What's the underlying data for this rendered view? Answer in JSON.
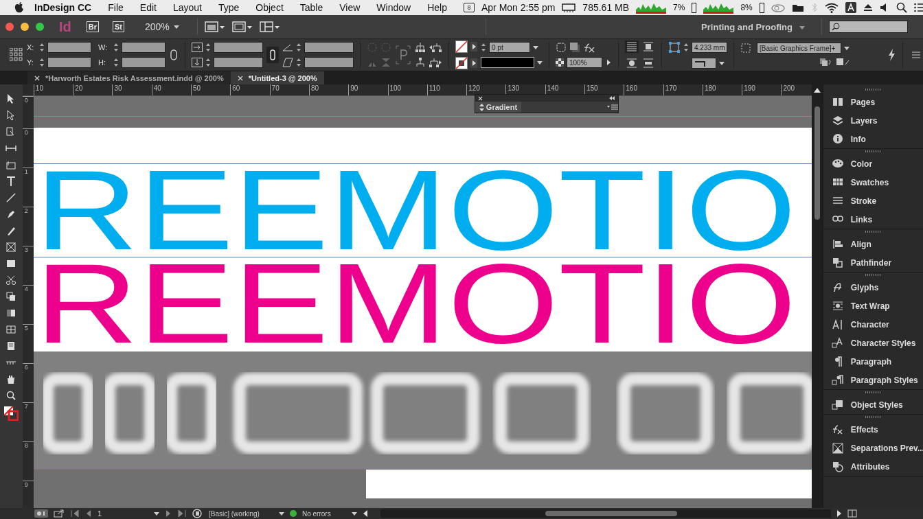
{
  "menu_bar": {
    "app_name": "InDesign CC",
    "menus": [
      "File",
      "Edit",
      "Layout",
      "Type",
      "Object",
      "Table",
      "View",
      "Window",
      "Help"
    ],
    "calendar_day": "8",
    "clock": "Apr Mon 2:55 pm",
    "memory": "785.61 MB",
    "cpu_1": "7%",
    "cpu_2": "8%"
  },
  "app_bar": {
    "logo": "Id",
    "bridge": "Br",
    "stock": "St",
    "zoom": "200%",
    "workspace": "Printing and Proofing"
  },
  "control_bar": {
    "x_label": "X:",
    "y_label": "Y:",
    "w_label": "W:",
    "h_label": "H:",
    "stroke_weight": "0 pt",
    "opacity": "100%",
    "offset": "4.233 mm",
    "object_style": "[Basic Graphics Frame]+"
  },
  "tabs": [
    {
      "label": "*Harworth Estates Risk Assessment.indd @ 200%",
      "selected": false
    },
    {
      "label": "*Untitled-3 @ 200%",
      "selected": true
    }
  ],
  "ruler": {
    "horizontal": [
      "10",
      "20",
      "30",
      "40",
      "50",
      "60",
      "70",
      "80",
      "90",
      "100",
      "110",
      "120",
      "130",
      "140",
      "150",
      "160",
      "170",
      "180",
      "190",
      "200"
    ],
    "vertical": [
      "0",
      "0",
      "1",
      "2",
      "3",
      "4",
      "5",
      "6",
      "7",
      "8",
      "9"
    ]
  },
  "gradient_panel": {
    "title": "Gradient"
  },
  "document": {
    "lines": [
      {
        "text": "REEMOTIO",
        "color": "#00aeef"
      },
      {
        "text": "REEMOTIO",
        "color": "#ec008c"
      }
    ]
  },
  "panels": [
    {
      "items": [
        "Pages",
        "Layers",
        "Info"
      ]
    },
    {
      "items": [
        "Color",
        "Swatches",
        "Stroke",
        "Links"
      ]
    },
    {
      "items": [
        "Align",
        "Pathfinder"
      ]
    },
    {
      "items": [
        "Glyphs",
        "Text Wrap",
        "Character",
        "Character Styles",
        "Paragraph",
        "Paragraph Styles"
      ]
    },
    {
      "items": [
        "Object Styles"
      ]
    },
    {
      "items": [
        "Effects",
        "Separations Prev...",
        "Attributes"
      ]
    }
  ],
  "status_bar": {
    "page": "1",
    "preflight_profile": "[Basic] (working)",
    "preflight_status": "No errors"
  }
}
